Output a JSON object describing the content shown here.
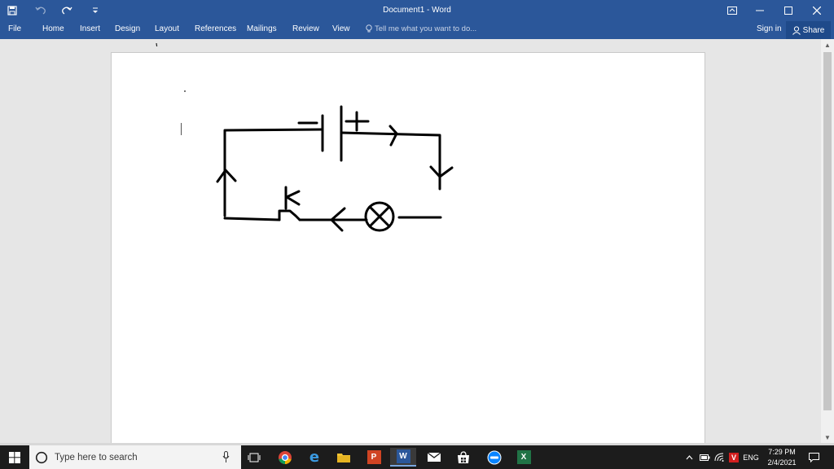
{
  "window": {
    "title": "Document1 - Word"
  },
  "ribbon": {
    "tabs": [
      "File",
      "Home",
      "Insert",
      "Design",
      "Layout",
      "References",
      "Mailings",
      "Review",
      "View"
    ],
    "tell_me": "Tell me what you want to do...",
    "sign_in": "Sign in",
    "share": "Share"
  },
  "colors": {
    "accent": "#2b579a",
    "taskbar": "#1c1c1c"
  },
  "diagram": {
    "labels": {
      "battery_minus": "−",
      "battery_plus": "+",
      "switch": "K"
    }
  },
  "taskbar": {
    "search_placeholder": "Type here to search",
    "apps": [
      "task-view",
      "chrome",
      "edge",
      "file-explorer",
      "powerpoint",
      "word",
      "mail",
      "store",
      "zalo",
      "excel"
    ],
    "tray_language": "ENG",
    "time": "7:29 PM",
    "date": "2/4/2021"
  }
}
